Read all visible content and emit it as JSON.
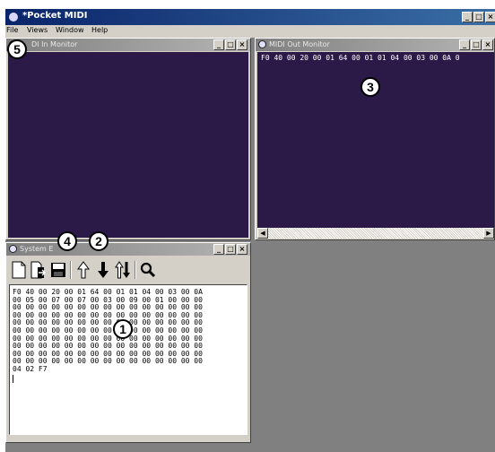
{
  "app": {
    "title": "*Pocket MIDI",
    "menu": [
      "File",
      "Views",
      "Window",
      "Help"
    ]
  },
  "controls": {
    "minimize": "_",
    "maximize": "□",
    "close": "×"
  },
  "midi_in": {
    "title": "MIDI In Monitor",
    "title_visible": "DI In Monitor"
  },
  "midi_out": {
    "title": "MIDI Out Monitor",
    "text": "F0 40 00 20 00 01 64 00 01 01 04 00 03 00 0A 0"
  },
  "sysex": {
    "title": "System Exclusive",
    "title_visible": "System E",
    "toolbar": [
      "new-icon",
      "open-icon",
      "save-icon",
      "arrow-up-icon",
      "arrow-down-icon",
      "up-down-arrows-icon",
      "search-icon"
    ],
    "rows": [
      "F0 40 00 20 00 01 64 00 01 01 04 00 03 00 0A",
      "00 05 00 07 00 07 00 03 00 09 00 01 00 00 00",
      "00 00 00 00 00 00 00 00 00 00 00 00 00 00 00",
      "00 00 00 00 00 00 00 00 00 00 00 00 00 00 00",
      "00 00 00 00 00 00 00 00 00 00 00 00 00 00 00",
      "00 00 00 00 00 00 00 00 00 00 00 00 00 00 00",
      "00 00 00 00 00 00 00 00 00 00 00 00 00 00 00",
      "00 00 00 00 00 00 00 00 00 00 00 00 00 00 00",
      "00 00 00 00 00 00 00 00 00 00 00 00 00 00 00",
      "00 00 00 00 00 00 00 00 00 00 00 00 00 00 00",
      "04 02 F7"
    ]
  },
  "callouts": [
    "1",
    "2",
    "3",
    "4",
    "5"
  ]
}
